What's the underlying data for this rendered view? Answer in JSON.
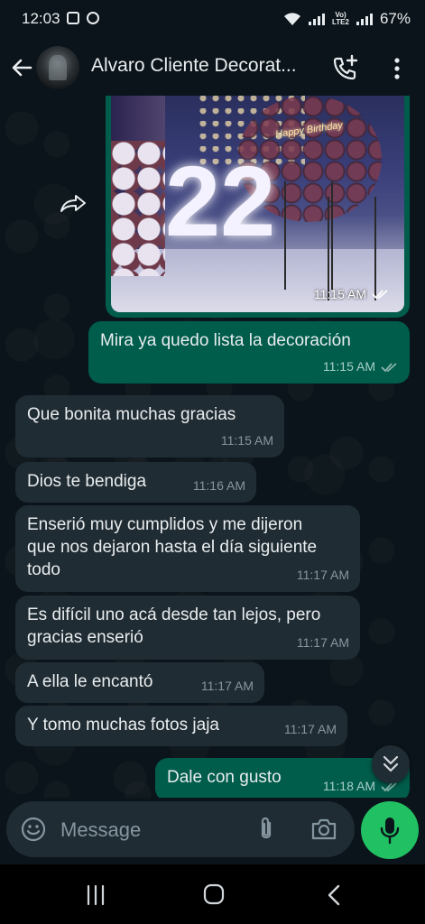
{
  "status_bar": {
    "time": "12:03",
    "battery": "67%",
    "network": "LTE2",
    "volte": "Vo)"
  },
  "header": {
    "contact_name": "Alvaro Cliente Decorat...",
    "icons": [
      "back-arrow-icon",
      "contact-avatar",
      "add-call-icon",
      "more-options-icon"
    ]
  },
  "image_message": {
    "time": "11:15 AM",
    "status": "read",
    "photo_text": {
      "number": "22",
      "neon_sign": "Happy Birthday"
    }
  },
  "messages": [
    {
      "direction": "out",
      "text": "Mira ya quedo lista la decoración",
      "time": "11:15 AM",
      "status": "read"
    },
    {
      "direction": "in",
      "text": "Que bonita muchas gracias",
      "time": "11:15 AM"
    },
    {
      "direction": "in",
      "text": "Dios te bendiga",
      "time": "11:16 AM"
    },
    {
      "direction": "in",
      "text": "Enserió muy cumplidos y me dijeron que nos dejaron hasta el día siguiente todo",
      "time": "11:17 AM"
    },
    {
      "direction": "in",
      "text": "Es difícil uno acá desde tan lejos, pero gracias enserió",
      "time": "11:17 AM"
    },
    {
      "direction": "in",
      "text": "A ella le encantó",
      "time": "11:17 AM"
    },
    {
      "direction": "in",
      "text": "Y tomo muchas fotos jaja",
      "time": "11:17 AM"
    },
    {
      "direction": "out",
      "text": "Dale con gusto",
      "time": "11:18 AM",
      "status": "read"
    }
  ],
  "composer": {
    "placeholder": "Message"
  },
  "colors": {
    "background": "#0b141a",
    "incoming_bubble": "#202c33",
    "outgoing_bubble": "#005c4b",
    "accent_green": "#21c063",
    "read_ticks": "#53bdeb"
  }
}
